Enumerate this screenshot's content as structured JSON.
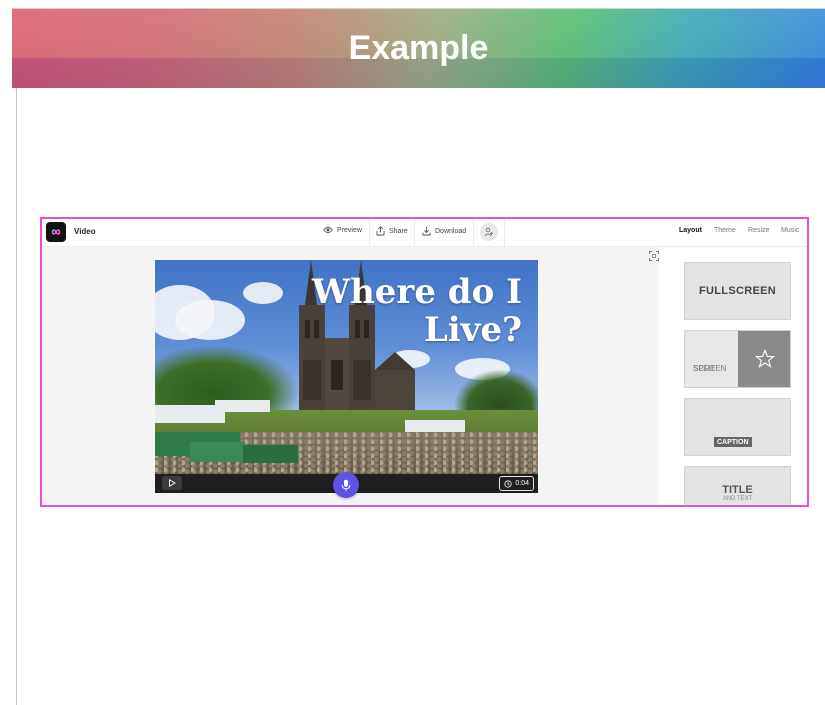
{
  "banner": {
    "title": "Example"
  },
  "app": {
    "title": "Video",
    "toolbar": {
      "preview": "Preview",
      "share": "Share",
      "download": "Download"
    },
    "tabs": [
      {
        "label": "Layout",
        "active": true
      },
      {
        "label": "Theme",
        "active": false
      },
      {
        "label": "Resize",
        "active": false
      },
      {
        "label": "Music",
        "active": false
      }
    ]
  },
  "canvas": {
    "headline_line1": "Where do I",
    "headline_line2": "Live?",
    "timer": "0:04"
  },
  "layouts": {
    "fullscreen": "FULLSCREEN",
    "split_line1": "SPLIT",
    "split_line2": "SCREEN",
    "caption": "CAPTION",
    "title": "TITLE",
    "title_sub": "AND TEXT"
  },
  "colors": {
    "frame_border": "#e64fd4",
    "mic_button": "#5d53e6"
  }
}
